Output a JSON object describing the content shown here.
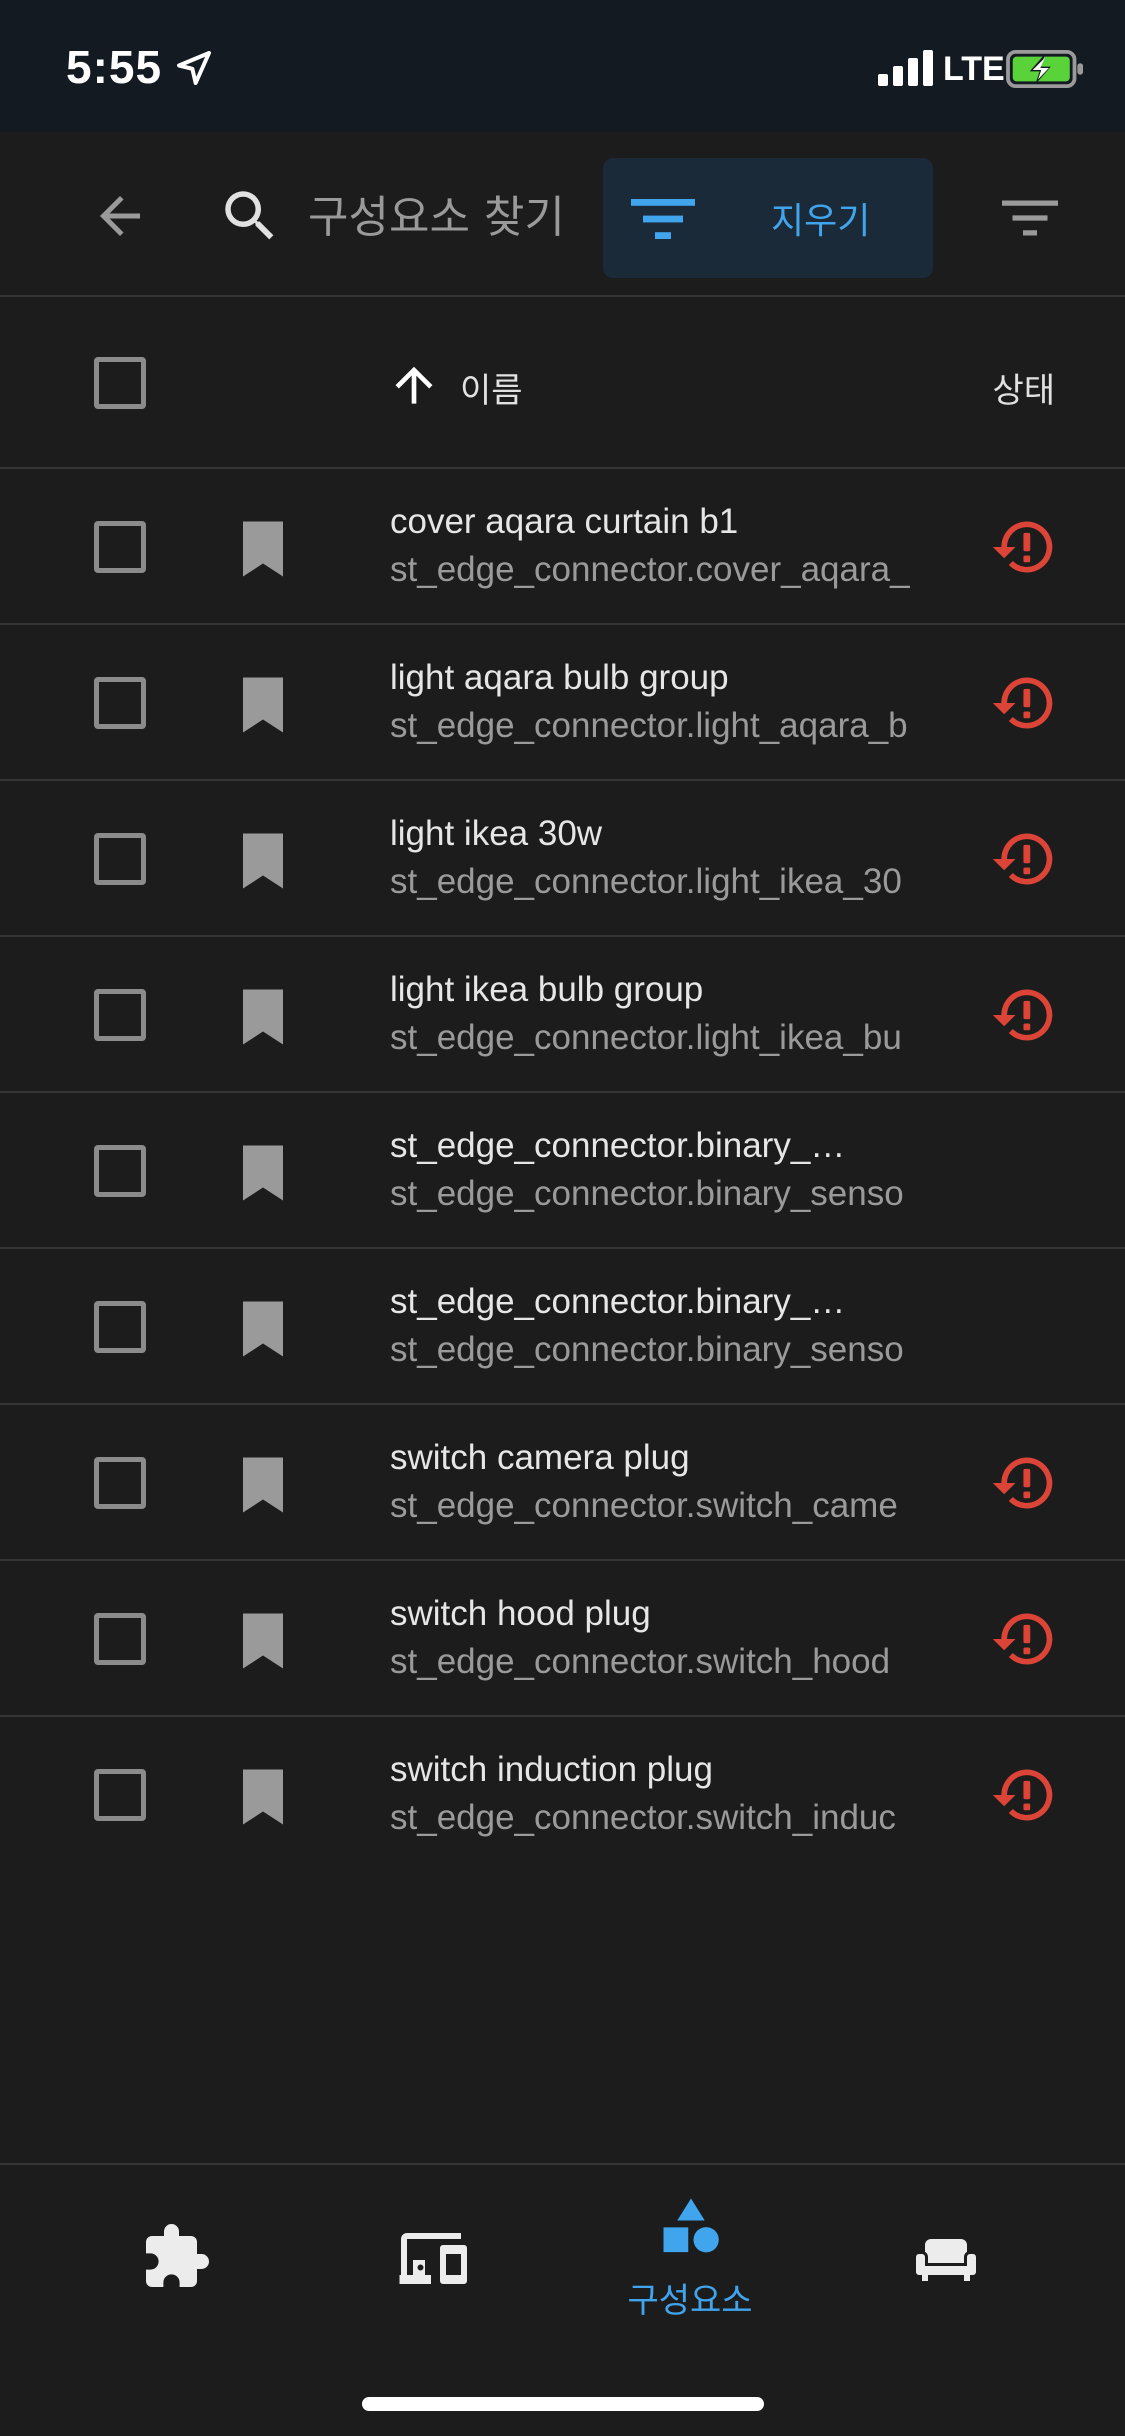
{
  "status_bar": {
    "time": "5:55",
    "network": "LTE",
    "icons": [
      "location-arrow-icon",
      "signal-icon",
      "battery-charging-icon"
    ]
  },
  "app_bar": {
    "back_icon": "arrow-left-icon",
    "search_icon": "magnify-icon",
    "search_placeholder": "구성요소 찾기",
    "search_value": "",
    "clear_filter_label": "지우기",
    "filter_icon": "filter-variant-icon"
  },
  "table": {
    "sort_icon": "arrow-up-icon",
    "col_name": "이름",
    "col_status": "상태",
    "rows": [
      {
        "name": "cover aqara curtain b1",
        "entity_id": "st_edge_connector.cover_aqara_",
        "status": "unavailable"
      },
      {
        "name": "light aqara bulb group",
        "entity_id": "st_edge_connector.light_aqara_b",
        "status": "unavailable"
      },
      {
        "name": "light ikea 30w",
        "entity_id": "st_edge_connector.light_ikea_30",
        "status": "unavailable"
      },
      {
        "name": "light ikea bulb group",
        "entity_id": "st_edge_connector.light_ikea_bu",
        "status": "unavailable"
      },
      {
        "name": "st_edge_connector.binary_…",
        "entity_id": "st_edge_connector.binary_senso",
        "status": ""
      },
      {
        "name": "st_edge_connector.binary_…",
        "entity_id": "st_edge_connector.binary_senso",
        "status": ""
      },
      {
        "name": "switch camera plug",
        "entity_id": "st_edge_connector.switch_came",
        "status": "unavailable"
      },
      {
        "name": "switch hood plug",
        "entity_id": "st_edge_connector.switch_hood",
        "status": "unavailable"
      },
      {
        "name": "switch induction plug",
        "entity_id": "st_edge_connector.switch_induc",
        "status": "unavailable"
      }
    ]
  },
  "bottom_nav": {
    "items": [
      {
        "icon": "puzzle-icon",
        "label": ""
      },
      {
        "icon": "devices-icon",
        "label": ""
      },
      {
        "icon": "shape-icon",
        "label": "구성요소",
        "active": true
      },
      {
        "icon": "sofa-icon",
        "label": ""
      }
    ]
  },
  "colors": {
    "background": "#1c1c1c",
    "status_bar": "#141a22",
    "accent": "#41a5ee",
    "error": "#db4437",
    "divider": "#353535"
  }
}
